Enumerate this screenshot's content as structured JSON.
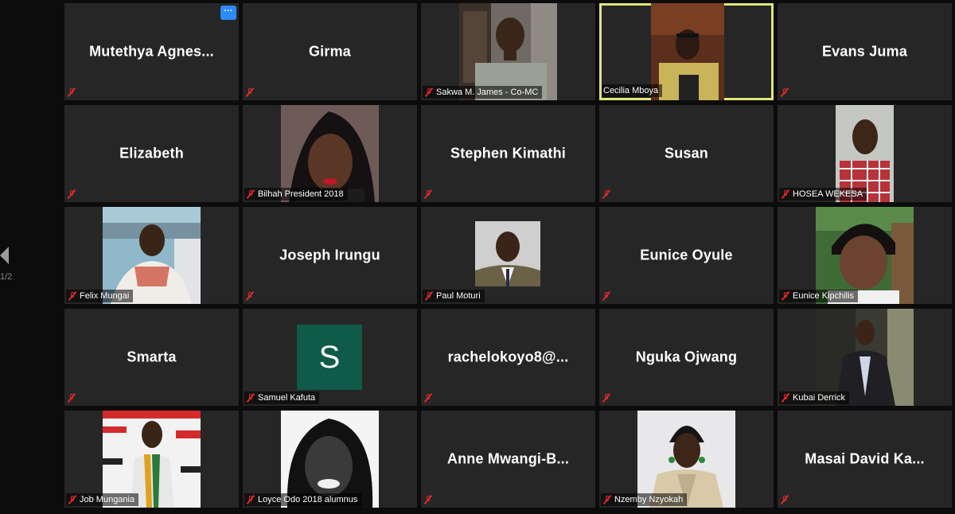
{
  "page_indicator": "1/2",
  "more_button_label": "···",
  "tiles": [
    {
      "display": "Mutethya  Agnes...",
      "muted": true
    },
    {
      "display": "Girma",
      "muted": true
    },
    {
      "label": "Sakwa M. James - Co-MC",
      "muted": true,
      "photo": "man-office"
    },
    {
      "label": "Cecilia Mboya",
      "muted": false,
      "active": true,
      "photo": "woman-glasses"
    },
    {
      "display": "Evans Juma",
      "muted": true
    },
    {
      "display": "Elizabeth",
      "muted": true
    },
    {
      "label": "Bilhah President 2018",
      "muted": true,
      "photo": "woman-red-lips"
    },
    {
      "display": "Stephen Kimathi",
      "muted": true
    },
    {
      "display": "Susan",
      "muted": true
    },
    {
      "label": "HOSEA WEKESA",
      "muted": true,
      "photo": "man-plaid"
    },
    {
      "label": "Felix Mungai",
      "muted": true,
      "photo": "man-white-shirt"
    },
    {
      "display": "Joseph Irungu",
      "muted": true
    },
    {
      "label": "Paul Moturi",
      "muted": true,
      "photo": "man-suit"
    },
    {
      "display": "Eunice Oyule",
      "muted": true
    },
    {
      "label": "Eunice Kipchilis",
      "muted": true,
      "photo": "woman-smiling"
    },
    {
      "display": "Smarta",
      "muted": true
    },
    {
      "label": "Samuel Kafuta",
      "muted": true,
      "avatar_letter": "S"
    },
    {
      "display": "rachelokoyo8@...",
      "muted": true
    },
    {
      "display": "Nguka Ojwang",
      "muted": true
    },
    {
      "label": "Kubai Derrick",
      "muted": true,
      "photo": "man-blazer"
    },
    {
      "label": "Job Mungania",
      "muted": true,
      "photo": "man-banner"
    },
    {
      "label": "Loyce Odo 2018 alumnus",
      "muted": true,
      "photo": "woman-bw"
    },
    {
      "display": "Anne  Mwangi-B...",
      "muted": true
    },
    {
      "label": "Nzemby Nzyokah",
      "muted": true,
      "photo": "woman-trench"
    },
    {
      "display": "Masai  David  Ka...",
      "muted": true
    }
  ]
}
